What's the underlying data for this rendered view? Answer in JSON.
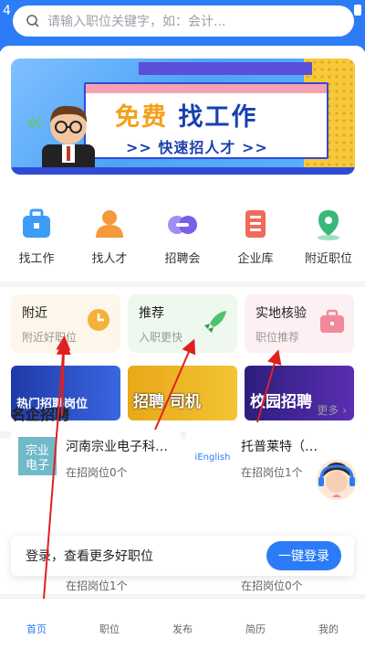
{
  "status": {
    "time_partial": "4"
  },
  "search": {
    "placeholder": "请输入职位关键字，如：会计..."
  },
  "banner": {
    "title_highlight": "免费",
    "title_main": "找工作",
    "subtitle": ">> 快速招人才 >>"
  },
  "quick_nav": [
    {
      "label": "找工作",
      "icon": "briefcase-icon",
      "color": "#3d9cf5"
    },
    {
      "label": "找人才",
      "icon": "person-icon",
      "color": "#f3993a"
    },
    {
      "label": "招聘会",
      "icon": "group-icon",
      "color": "#8a6cf0"
    },
    {
      "label": "企业库",
      "icon": "building-icon",
      "color": "#f26a5a"
    },
    {
      "label": "附近职位",
      "icon": "location-pin-icon",
      "color": "#3ab87a"
    }
  ],
  "features": [
    {
      "title": "附近",
      "sub": "附近好职位",
      "icon": "clock-icon",
      "color": "#f5b23a"
    },
    {
      "title": "推荐",
      "sub": "入职更快",
      "icon": "rocket-icon",
      "color": "#4cc36a"
    },
    {
      "title": "实地核验",
      "sub": "职位推荐",
      "icon": "briefcase-icon",
      "color": "#f3879c"
    }
  ],
  "promos": [
    {
      "text": "热门招聘岗位"
    },
    {
      "text": "招聘  司机"
    },
    {
      "text": "校园招聘"
    }
  ],
  "section": {
    "title": "名企招聘",
    "more": "更多 ›"
  },
  "companies": [
    {
      "name": "河南宗业电子科…",
      "jobs": "在招岗位0个",
      "logo_text": "宗业\n电子",
      "logo_color": "#6fb9c9"
    },
    {
      "name": "托普莱特（…",
      "jobs": "在招岗位1个",
      "logo_text": "iEnglish",
      "logo_color": "#e9f2ff"
    }
  ],
  "row2": [
    {
      "jobs": "在招岗位1个"
    },
    {
      "jobs": "在招岗位0个"
    }
  ],
  "login": {
    "text": "登录，查看更多好职位",
    "button": "一键登录"
  },
  "tabs": [
    {
      "label": "首页",
      "active": true
    },
    {
      "label": "职位",
      "active": false
    },
    {
      "label": "发布",
      "active": false
    },
    {
      "label": "简历",
      "active": false
    },
    {
      "label": "我的",
      "active": false
    }
  ]
}
